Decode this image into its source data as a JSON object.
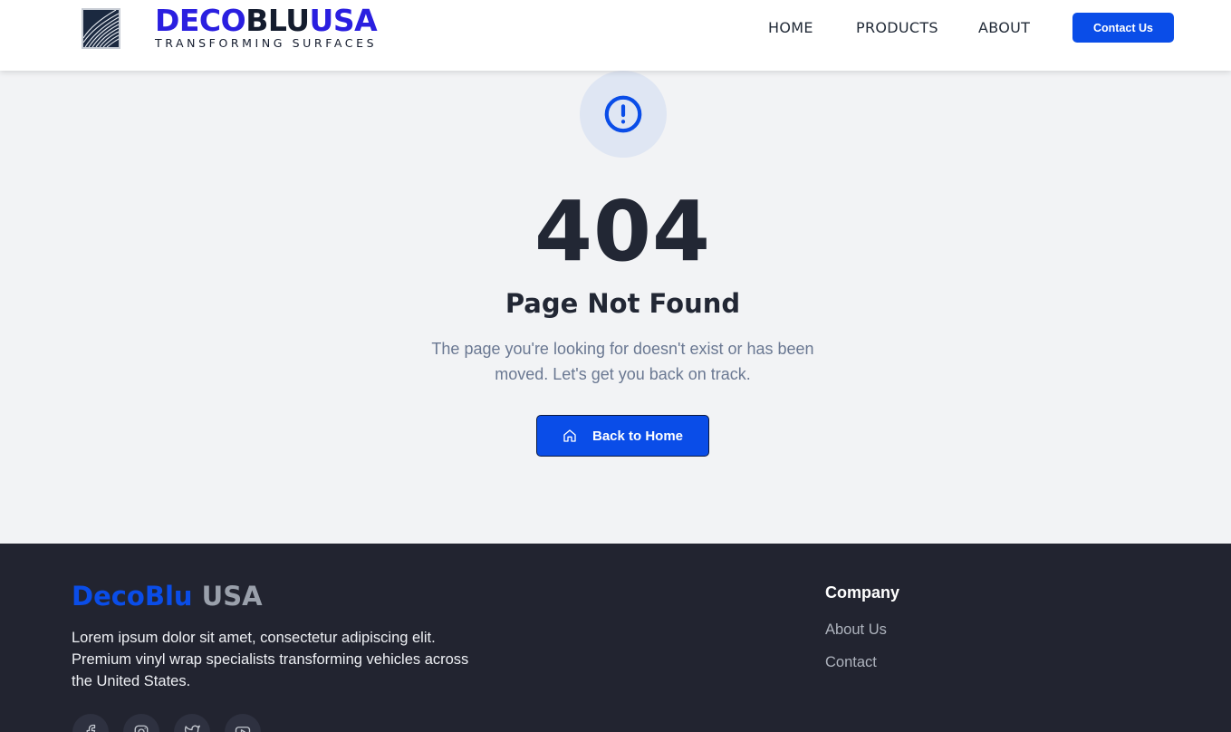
{
  "header": {
    "brand_part1": "DECO",
    "brand_part2": "BLU",
    "brand_part3": "USA",
    "tagline": "TRANSFORMING SURFACES",
    "nav": [
      "HOME",
      "PRODUCTS",
      "ABOUT"
    ],
    "contact_label": "Contact Us"
  },
  "main": {
    "icon": "alert-circle-icon",
    "code": "404",
    "title": "Page Not Found",
    "message": "The page you're looking for doesn't exist or has been moved. Let's get you back on track.",
    "button_label": "Back to Home",
    "button_icon": "home-icon"
  },
  "footer": {
    "brand_part1": "DecoBlu",
    "brand_part2": "USA",
    "description": "Lorem ipsum dolor sit amet, consectetur adipiscing elit. Premium vinyl wrap specialists transforming vehicles across the United States.",
    "social_icons": [
      "facebook-icon",
      "instagram-icon",
      "twitter-icon",
      "youtube-icon"
    ],
    "company_heading": "Company",
    "links": [
      "About Us",
      "Contact"
    ]
  },
  "colors": {
    "primary": "#0a4de8",
    "brand_blue": "#2a1fe0",
    "dark_text": "#222734",
    "muted_text": "#6a7892",
    "footer_bg": "#222430",
    "page_bg": "#f2f3f5"
  }
}
